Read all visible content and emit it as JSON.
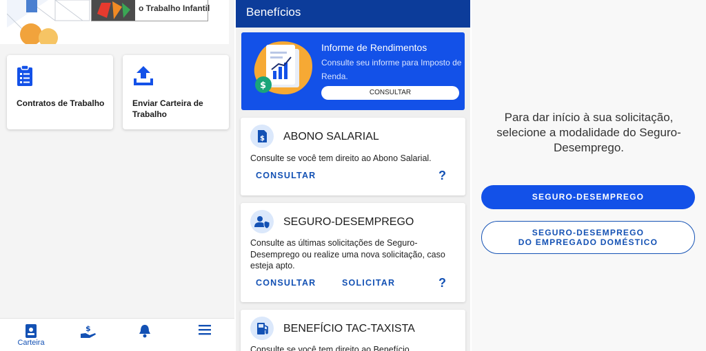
{
  "left": {
    "banner_text": "o Trabalho Infantil",
    "cards": [
      {
        "label": "Contratos de Trabalho",
        "icon": "clipboard-list-icon"
      },
      {
        "label": "Enviar Carteira de Trabalho",
        "icon": "upload-icon"
      }
    ],
    "nav": [
      {
        "label": "Carteira",
        "icon": "wallet-card-icon",
        "active": true
      },
      {
        "label": "",
        "icon": "hand-money-icon"
      },
      {
        "label": "",
        "icon": "bell-icon"
      },
      {
        "label": "",
        "icon": "menu-icon"
      }
    ]
  },
  "middle": {
    "header_title": "Benefícios",
    "info": {
      "title": "Informe de Rendimentos",
      "description": "Consulte seu informe para Imposto de Renda.",
      "button": "CONSULTAR"
    },
    "cards": [
      {
        "title": "ABONO SALARIAL",
        "description": "Consulte se você tem direito ao Abono Salarial.",
        "actions": [
          "CONSULTAR"
        ],
        "help": "?"
      },
      {
        "title": "SEGURO-DESEMPREGO",
        "description": "Consulte as últimas solicitações de Seguro-Desemprego ou realize uma nova solicitação, caso esteja apto.",
        "actions": [
          "CONSULTAR",
          "SOLICITAR"
        ],
        "help": "?"
      },
      {
        "title": "BENEFÍCIO TAC-TAXISTA",
        "description": "Consulte se você tem direito ao Benefício"
      }
    ]
  },
  "right": {
    "instruction": "Para dar início à sua solicitação, selecione a modalidade do Seguro-Desemprego.",
    "option1": "SEGURO-DESEMPREGO",
    "option2_line1": "SEGURO-DESEMPREGO",
    "option2_line2": "DO EMPREGADO DOMÉSTICO"
  },
  "colors": {
    "primary": "#1351b4",
    "bright_blue": "#1351e8",
    "header_blue": "#0c3c9a"
  }
}
